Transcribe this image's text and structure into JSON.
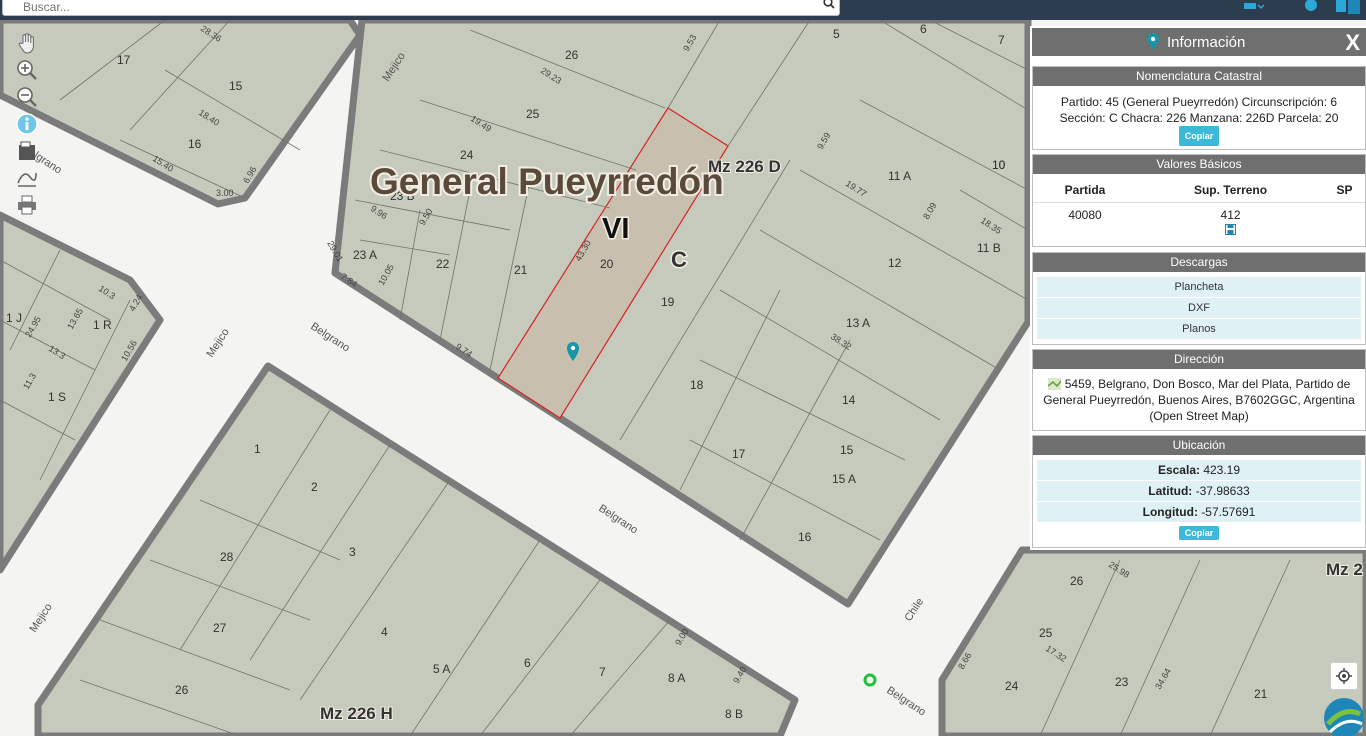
{
  "search": {
    "placeholder": "Buscar..."
  },
  "colors": {
    "parcel": "#c6cabc",
    "road": "#f4f4f2",
    "block_border": "#7b7b7b",
    "selected": "#c9bfae",
    "selected_border": "#d42424",
    "panel_header": "#6f6f6f",
    "accent": "#3cb8d8"
  },
  "icons": [
    "search-icon",
    "pan-hand-icon",
    "zoom-in-icon",
    "zoom-out-icon",
    "info-icon",
    "layers-icon",
    "measure-icon",
    "print-icon",
    "map-pin-icon",
    "close-icon",
    "save-icon",
    "address-map-icon",
    "locate-icon"
  ],
  "map": {
    "overlay": {
      "partido": "General Pueyrredón",
      "circunscripcion": "VI",
      "seccion": "C",
      "mz_226d": "Mz 226 D",
      "mz_226h": "Mz 226 H",
      "mz_2": "Mz 2"
    },
    "streets": {
      "mejico": "Mejico",
      "belgrano": "Belgrano",
      "chile": "Chile"
    },
    "parcel_numbers": [
      "26",
      "25",
      "24",
      "23 B",
      "23 A",
      "22",
      "21",
      "20",
      "19",
      "18",
      "17",
      "16",
      "15",
      "14",
      "13 A",
      "12",
      "11 A",
      "11 B",
      "10",
      "7",
      "6",
      "5",
      "1 J",
      "1 R",
      "1 S",
      "1",
      "2",
      "3",
      "4",
      "5 A",
      "6",
      "7",
      "8 A",
      "8 B",
      "27",
      "28",
      "26",
      "15 A",
      "25",
      "24",
      "23",
      "21",
      "17",
      "16",
      "15",
      "26",
      "10"
    ],
    "measures": [
      "9.53",
      "28.36",
      "29.23",
      "19.49",
      "9.96",
      "43.30",
      "29.01",
      "3.00",
      "6.96",
      "18.40",
      "15.40",
      "9.74",
      "10.05",
      "7.84",
      "38.32",
      "19.77",
      "8.09",
      "18.35",
      "8.66",
      "17.32",
      "25.98",
      "34.64",
      "13.3",
      "13.65",
      "10.3",
      "24.95",
      "11.3",
      "10.56",
      "4.24",
      "9.50",
      "9.59",
      "9.40",
      "9.00"
    ]
  },
  "panel": {
    "title": "Información",
    "close": "X",
    "nomenclatura": {
      "header": "Nomenclatura Catastral",
      "text": "Partido: 45 (General Pueyrredón) Circunscripción: 6 Sección: C Chacra: 226 Manzana: 226D Parcela: 20",
      "copy": "Copiar"
    },
    "valores": {
      "header": "Valores Básicos",
      "col_partida": "Partida",
      "col_sup": "Sup. Terreno",
      "col_sp": "SP",
      "partida": "40080",
      "sup": "412",
      "sp": ""
    },
    "descargas": {
      "header": "Descargas",
      "items": [
        "Plancheta",
        "DXF",
        "Planos"
      ]
    },
    "direccion": {
      "header": "Dirección",
      "text": "5459, Belgrano, Don Bosco, Mar del Plata, Partido de General Pueyrredón, Buenos Aires, B7602GGC, Argentina (Open Street Map)"
    },
    "ubicacion": {
      "header": "Ubicación",
      "escala_label": "Escala:",
      "escala": "423.19",
      "latitud_label": "Latitud:",
      "latitud": "-37.98633",
      "longitud_label": "Longitud:",
      "longitud": "-57.57691",
      "copy": "Copiar"
    }
  }
}
